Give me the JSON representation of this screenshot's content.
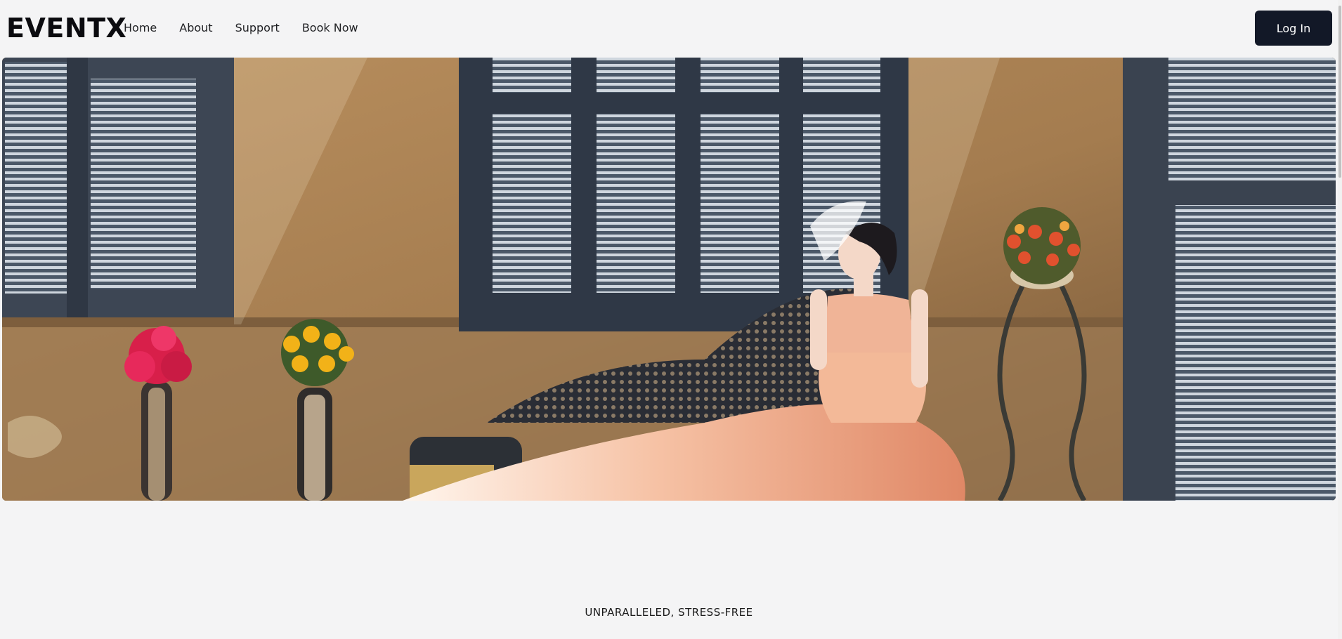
{
  "brand": {
    "name": "EVENTX"
  },
  "nav": {
    "items": [
      {
        "label": "Home"
      },
      {
        "label": "About"
      },
      {
        "label": "Support"
      },
      {
        "label": "Book Now"
      }
    ]
  },
  "header": {
    "login_label": "Log In"
  },
  "hero": {
    "image": "bride-in-peach-ruffled-gown-on-chaise"
  },
  "section": {
    "tagline": "UNPARALLELED, STRESS-FREE"
  },
  "colors": {
    "background": "#f4f4f5",
    "button": "#121827",
    "button_text": "#ffffff"
  }
}
